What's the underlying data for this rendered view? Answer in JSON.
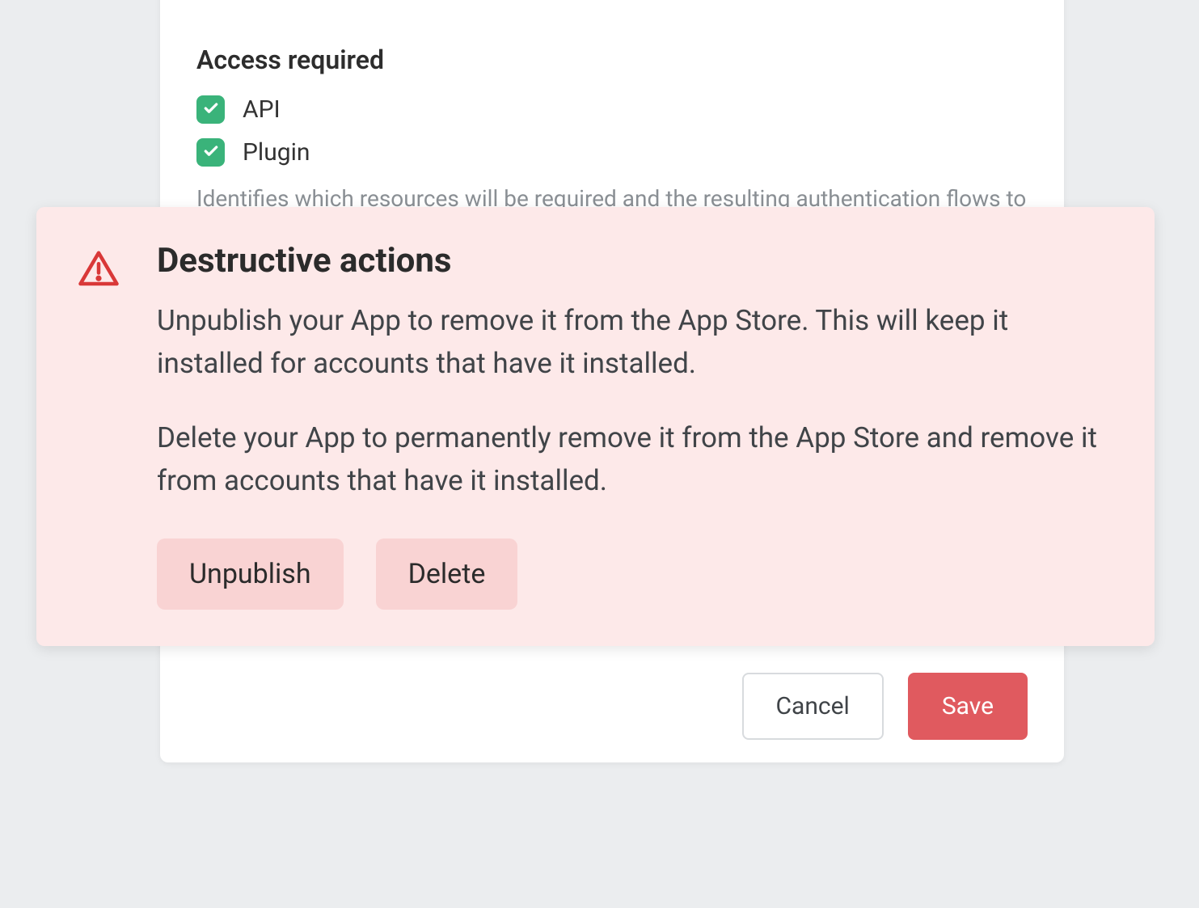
{
  "access_section": {
    "title": "Access required",
    "items": [
      {
        "label": "API",
        "checked": true
      },
      {
        "label": "Plugin",
        "checked": true
      }
    ],
    "helper": "Identifies which resources will be required and the resulting authentication flows to be set up"
  },
  "footer": {
    "cancel_label": "Cancel",
    "save_label": "Save"
  },
  "destructive": {
    "title": "Destructive actions",
    "paragraph_unpublish": "Unpublish your App to remove it from the App Store. This will keep it installed for accounts that have it installed.",
    "paragraph_delete": "Delete your App to permanently remove it from the App Store and remove it from accounts that have it installed.",
    "unpublish_label": "Unpublish",
    "delete_label": "Delete"
  },
  "colors": {
    "page_bg": "#ebedef",
    "card_bg": "#ffffff",
    "checkbox_bg": "#3ab37a",
    "helper_text": "#8a8f94",
    "alert_bg": "#fde9e9",
    "alert_icon": "#d93838",
    "btn_save_bg": "#e05a5f",
    "btn_destructive_bg": "#f9d3d3"
  }
}
